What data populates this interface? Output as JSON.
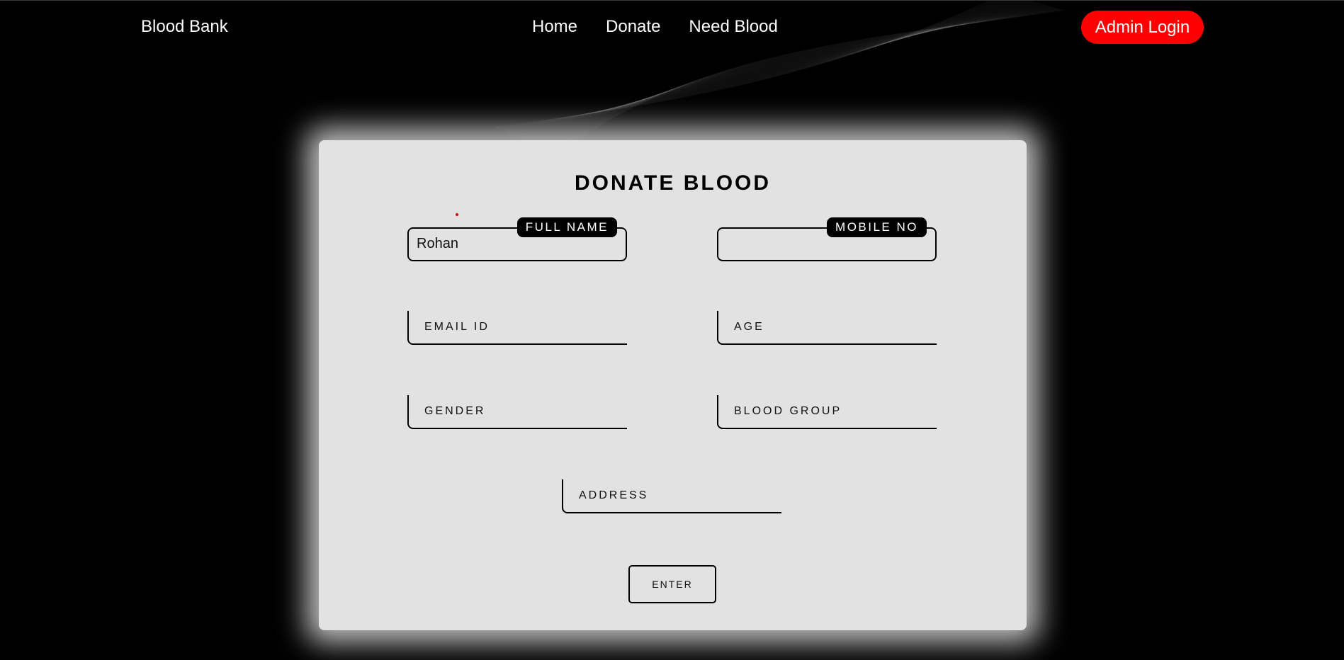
{
  "navbar": {
    "brand": "Blood Bank",
    "links": [
      "Home",
      "Donate",
      "Need Blood"
    ],
    "admin_button": "Admin Login"
  },
  "form": {
    "title": "DONATE BLOOD",
    "fields": {
      "full_name": {
        "label": "FULL NAME",
        "value": "Rohan"
      },
      "mobile_no": {
        "label": "MOBILE NO",
        "value": ""
      },
      "email_id": {
        "placeholder": "EMAIL ID"
      },
      "age": {
        "placeholder": "AGE"
      },
      "gender": {
        "placeholder": "GENDER"
      },
      "blood_group": {
        "placeholder": "BLOOD GROUP"
      },
      "address": {
        "placeholder": "ADDRESS"
      }
    },
    "submit_label": "ENTER"
  },
  "colors": {
    "accent": "#ff0000",
    "background": "#000000",
    "card": "#e2e2e2"
  }
}
